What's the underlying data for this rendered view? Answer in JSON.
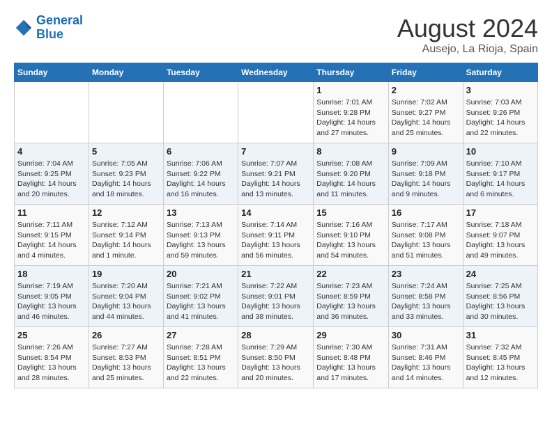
{
  "header": {
    "logo_line1": "General",
    "logo_line2": "Blue",
    "month": "August 2024",
    "location": "Ausejo, La Rioja, Spain"
  },
  "days_of_week": [
    "Sunday",
    "Monday",
    "Tuesday",
    "Wednesday",
    "Thursday",
    "Friday",
    "Saturday"
  ],
  "weeks": [
    [
      {
        "day": "",
        "info": ""
      },
      {
        "day": "",
        "info": ""
      },
      {
        "day": "",
        "info": ""
      },
      {
        "day": "",
        "info": ""
      },
      {
        "day": "1",
        "info": "Sunrise: 7:01 AM\nSunset: 9:28 PM\nDaylight: 14 hours and 27 minutes."
      },
      {
        "day": "2",
        "info": "Sunrise: 7:02 AM\nSunset: 9:27 PM\nDaylight: 14 hours and 25 minutes."
      },
      {
        "day": "3",
        "info": "Sunrise: 7:03 AM\nSunset: 9:26 PM\nDaylight: 14 hours and 22 minutes."
      }
    ],
    [
      {
        "day": "4",
        "info": "Sunrise: 7:04 AM\nSunset: 9:25 PM\nDaylight: 14 hours and 20 minutes."
      },
      {
        "day": "5",
        "info": "Sunrise: 7:05 AM\nSunset: 9:23 PM\nDaylight: 14 hours and 18 minutes."
      },
      {
        "day": "6",
        "info": "Sunrise: 7:06 AM\nSunset: 9:22 PM\nDaylight: 14 hours and 16 minutes."
      },
      {
        "day": "7",
        "info": "Sunrise: 7:07 AM\nSunset: 9:21 PM\nDaylight: 14 hours and 13 minutes."
      },
      {
        "day": "8",
        "info": "Sunrise: 7:08 AM\nSunset: 9:20 PM\nDaylight: 14 hours and 11 minutes."
      },
      {
        "day": "9",
        "info": "Sunrise: 7:09 AM\nSunset: 9:18 PM\nDaylight: 14 hours and 9 minutes."
      },
      {
        "day": "10",
        "info": "Sunrise: 7:10 AM\nSunset: 9:17 PM\nDaylight: 14 hours and 6 minutes."
      }
    ],
    [
      {
        "day": "11",
        "info": "Sunrise: 7:11 AM\nSunset: 9:15 PM\nDaylight: 14 hours and 4 minutes."
      },
      {
        "day": "12",
        "info": "Sunrise: 7:12 AM\nSunset: 9:14 PM\nDaylight: 14 hours and 1 minute."
      },
      {
        "day": "13",
        "info": "Sunrise: 7:13 AM\nSunset: 9:13 PM\nDaylight: 13 hours and 59 minutes."
      },
      {
        "day": "14",
        "info": "Sunrise: 7:14 AM\nSunset: 9:11 PM\nDaylight: 13 hours and 56 minutes."
      },
      {
        "day": "15",
        "info": "Sunrise: 7:16 AM\nSunset: 9:10 PM\nDaylight: 13 hours and 54 minutes."
      },
      {
        "day": "16",
        "info": "Sunrise: 7:17 AM\nSunset: 9:08 PM\nDaylight: 13 hours and 51 minutes."
      },
      {
        "day": "17",
        "info": "Sunrise: 7:18 AM\nSunset: 9:07 PM\nDaylight: 13 hours and 49 minutes."
      }
    ],
    [
      {
        "day": "18",
        "info": "Sunrise: 7:19 AM\nSunset: 9:05 PM\nDaylight: 13 hours and 46 minutes."
      },
      {
        "day": "19",
        "info": "Sunrise: 7:20 AM\nSunset: 9:04 PM\nDaylight: 13 hours and 44 minutes."
      },
      {
        "day": "20",
        "info": "Sunrise: 7:21 AM\nSunset: 9:02 PM\nDaylight: 13 hours and 41 minutes."
      },
      {
        "day": "21",
        "info": "Sunrise: 7:22 AM\nSunset: 9:01 PM\nDaylight: 13 hours and 38 minutes."
      },
      {
        "day": "22",
        "info": "Sunrise: 7:23 AM\nSunset: 8:59 PM\nDaylight: 13 hours and 36 minutes."
      },
      {
        "day": "23",
        "info": "Sunrise: 7:24 AM\nSunset: 8:58 PM\nDaylight: 13 hours and 33 minutes."
      },
      {
        "day": "24",
        "info": "Sunrise: 7:25 AM\nSunset: 8:56 PM\nDaylight: 13 hours and 30 minutes."
      }
    ],
    [
      {
        "day": "25",
        "info": "Sunrise: 7:26 AM\nSunset: 8:54 PM\nDaylight: 13 hours and 28 minutes."
      },
      {
        "day": "26",
        "info": "Sunrise: 7:27 AM\nSunset: 8:53 PM\nDaylight: 13 hours and 25 minutes."
      },
      {
        "day": "27",
        "info": "Sunrise: 7:28 AM\nSunset: 8:51 PM\nDaylight: 13 hours and 22 minutes."
      },
      {
        "day": "28",
        "info": "Sunrise: 7:29 AM\nSunset: 8:50 PM\nDaylight: 13 hours and 20 minutes."
      },
      {
        "day": "29",
        "info": "Sunrise: 7:30 AM\nSunset: 8:48 PM\nDaylight: 13 hours and 17 minutes."
      },
      {
        "day": "30",
        "info": "Sunrise: 7:31 AM\nSunset: 8:46 PM\nDaylight: 13 hours and 14 minutes."
      },
      {
        "day": "31",
        "info": "Sunrise: 7:32 AM\nSunset: 8:45 PM\nDaylight: 13 hours and 12 minutes."
      }
    ]
  ]
}
